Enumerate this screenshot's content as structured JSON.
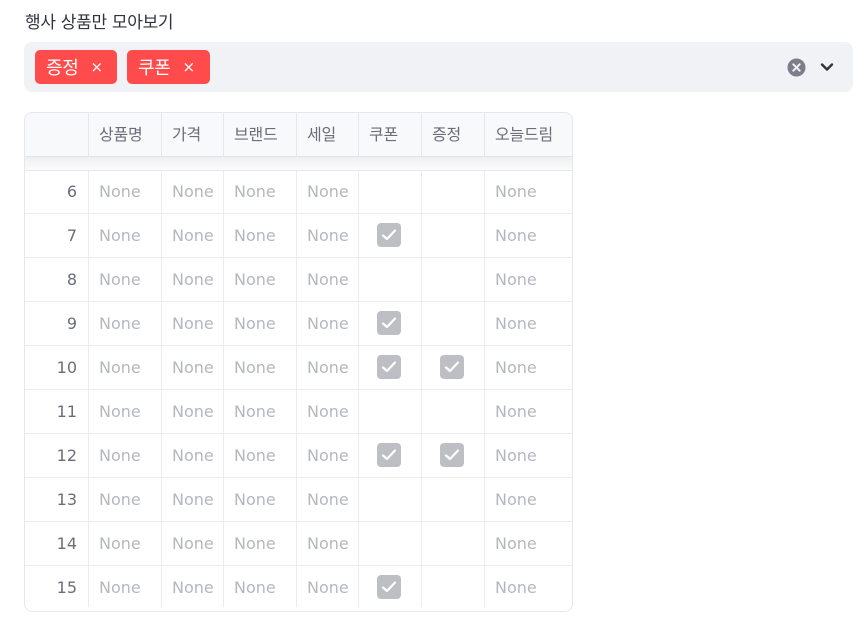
{
  "filter": {
    "label": "행사 상품만 모아보기",
    "chips": [
      {
        "label": "증정",
        "remove": "×"
      },
      {
        "label": "쿠폰",
        "remove": "×"
      }
    ],
    "accent_color": "#ff4b4b"
  },
  "table": {
    "columns": [
      "",
      "상품명",
      "가격",
      "브랜드",
      "세일",
      "쿠폰",
      "증정",
      "오늘드림"
    ],
    "rows": [
      {
        "index": "6",
        "name": "None",
        "price": "None",
        "brand": "None",
        "sale": "None",
        "coupon": false,
        "gift": false,
        "today": "None"
      },
      {
        "index": "7",
        "name": "None",
        "price": "None",
        "brand": "None",
        "sale": "None",
        "coupon": true,
        "gift": false,
        "today": "None"
      },
      {
        "index": "8",
        "name": "None",
        "price": "None",
        "brand": "None",
        "sale": "None",
        "coupon": false,
        "gift": false,
        "today": "None"
      },
      {
        "index": "9",
        "name": "None",
        "price": "None",
        "brand": "None",
        "sale": "None",
        "coupon": true,
        "gift": false,
        "today": "None"
      },
      {
        "index": "10",
        "name": "None",
        "price": "None",
        "brand": "None",
        "sale": "None",
        "coupon": true,
        "gift": true,
        "today": "None"
      },
      {
        "index": "11",
        "name": "None",
        "price": "None",
        "brand": "None",
        "sale": "None",
        "coupon": false,
        "gift": false,
        "today": "None"
      },
      {
        "index": "12",
        "name": "None",
        "price": "None",
        "brand": "None",
        "sale": "None",
        "coupon": true,
        "gift": true,
        "today": "None"
      },
      {
        "index": "13",
        "name": "None",
        "price": "None",
        "brand": "None",
        "sale": "None",
        "coupon": false,
        "gift": false,
        "today": "None"
      },
      {
        "index": "14",
        "name": "None",
        "price": "None",
        "brand": "None",
        "sale": "None",
        "coupon": false,
        "gift": false,
        "today": "None"
      },
      {
        "index": "15",
        "name": "None",
        "price": "None",
        "brand": "None",
        "sale": "None",
        "coupon": true,
        "gift": false,
        "today": "None"
      }
    ]
  },
  "icons": {
    "clear": "clear-circle-x-icon",
    "dropdown": "chevron-down-icon",
    "checkbox": "check-icon"
  }
}
